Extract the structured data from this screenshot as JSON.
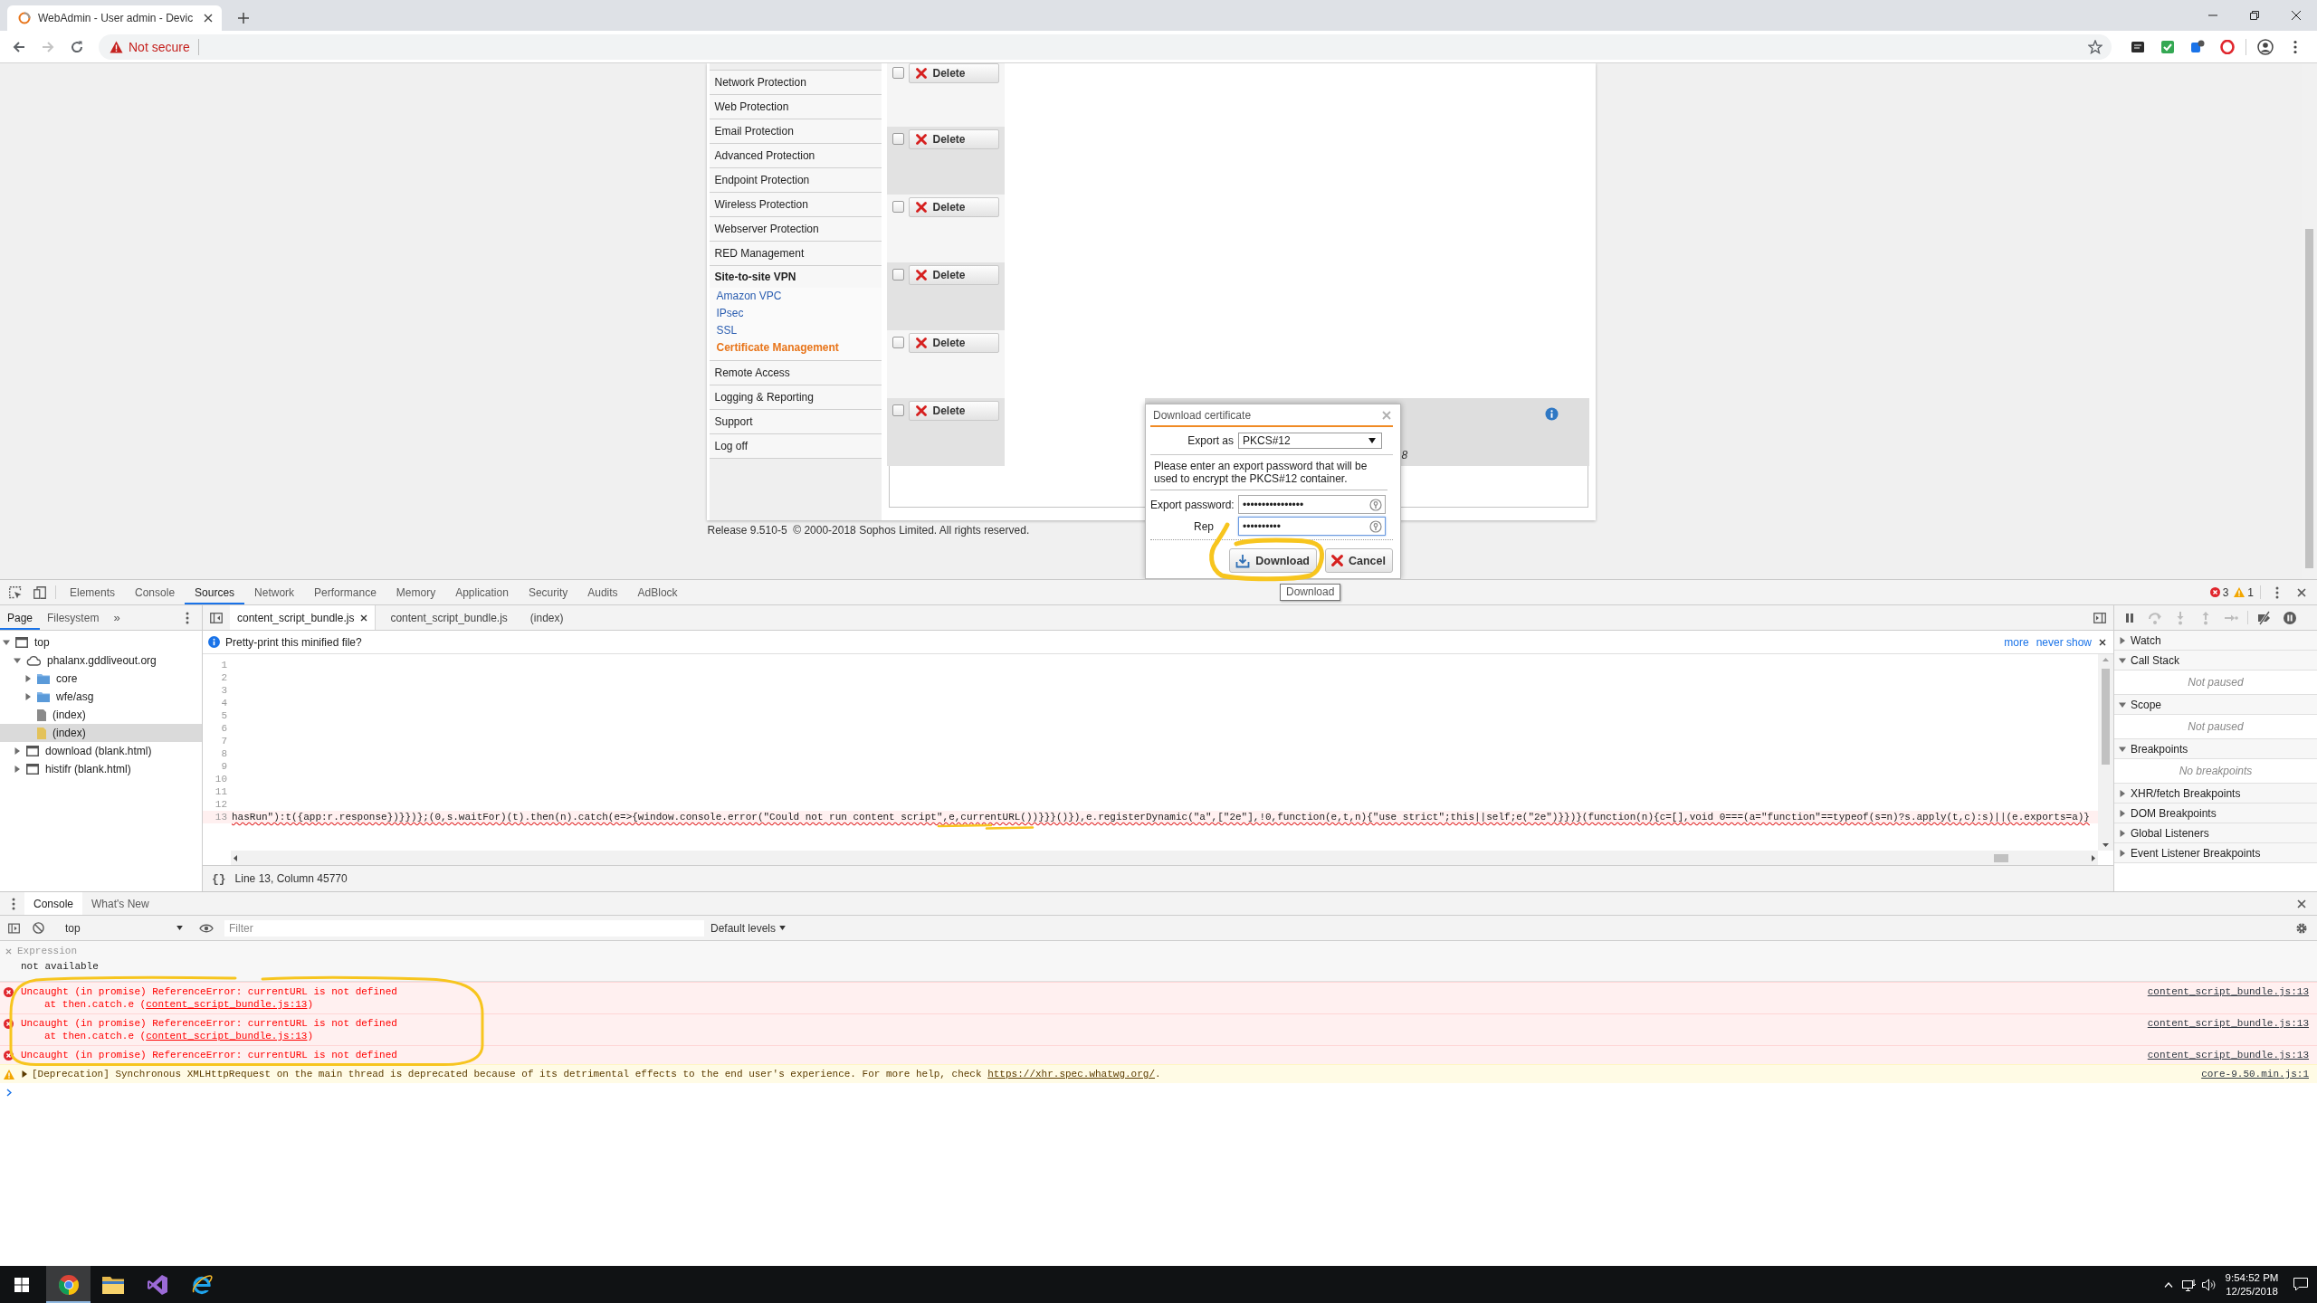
{
  "browser": {
    "tab_title": "WebAdmin - User admin - Devic",
    "back_enabled": true,
    "forward_enabled": false,
    "security_label": "Not secure"
  },
  "menu": [
    {
      "kind": "item",
      "label": "Network Protection",
      "selected": false
    },
    {
      "kind": "item",
      "label": "Web Protection",
      "selected": false
    },
    {
      "kind": "item",
      "label": "Email Protection",
      "selected": false
    },
    {
      "kind": "item",
      "label": "Advanced Protection",
      "selected": false
    },
    {
      "kind": "item",
      "label": "Endpoint Protection",
      "selected": false
    },
    {
      "kind": "item",
      "label": "Wireless Protection",
      "selected": false
    },
    {
      "kind": "item",
      "label": "Webserver Protection",
      "selected": false
    },
    {
      "kind": "item",
      "label": "RED Management",
      "selected": false
    },
    {
      "kind": "group",
      "label": "Site-to-site VPN",
      "selected": false,
      "expanded": true,
      "children": [
        {
          "label": "Amazon VPC",
          "selected": false
        },
        {
          "label": "IPsec",
          "selected": false
        },
        {
          "label": "SSL",
          "selected": false
        },
        {
          "label": "Certificate Management",
          "selected": true
        }
      ]
    },
    {
      "kind": "item",
      "label": "Remote Access",
      "selected": false
    },
    {
      "kind": "item",
      "label": "Logging & Reporting",
      "selected": false
    },
    {
      "kind": "item",
      "label": "Support",
      "selected": false
    },
    {
      "kind": "item",
      "label": "Log off",
      "selected": false
    }
  ],
  "rows": [
    {
      "checked": false,
      "action": "Delete"
    },
    {
      "checked": false,
      "action": "Delete"
    },
    {
      "checked": false,
      "action": "Delete"
    },
    {
      "checked": false,
      "action": "Delete"
    },
    {
      "checked": false,
      "action": "Delete"
    },
    {
      "checked": false,
      "action": "Delete",
      "fragment": "8"
    }
  ],
  "footer": "Release 9.510-5  © 2000-2018 Sophos Limited. All rights reserved.",
  "dialog": {
    "title": "Download certificate",
    "export_as": {
      "label": "Export as",
      "value": "PKCS#12"
    },
    "message": "Please enter an export password that will be used to encrypt the PKCS#12 container.",
    "fields": [
      {
        "label": "Export password:",
        "value": "••••••••••••••••",
        "focused": false
      },
      {
        "label": "Rep",
        "value": "••••••••••",
        "focused": true
      }
    ],
    "buttons": [
      {
        "kind": "download",
        "label": "Download"
      },
      {
        "kind": "cancel",
        "label": "Cancel"
      }
    ],
    "tooltip": "Download"
  },
  "devtools": {
    "tabs": [
      {
        "label": "Elements",
        "selected": false
      },
      {
        "label": "Console",
        "selected": false
      },
      {
        "label": "Sources",
        "selected": true
      },
      {
        "label": "Network",
        "selected": false
      },
      {
        "label": "Performance",
        "selected": false
      },
      {
        "label": "Memory",
        "selected": false
      },
      {
        "label": "Application",
        "selected": false
      },
      {
        "label": "Security",
        "selected": false
      },
      {
        "label": "Audits",
        "selected": false
      },
      {
        "label": "AdBlock",
        "selected": false
      }
    ],
    "error_count": "3",
    "warning_count": "1",
    "navigator": {
      "tabs": [
        {
          "label": "Page",
          "selected": true
        },
        {
          "label": "Filesystem",
          "selected": false
        }
      ],
      "overflow": "»",
      "tree": [
        {
          "kind": "frame",
          "label": "top",
          "expanded": true,
          "selected": false,
          "children": [
            {
              "kind": "domain",
              "label": "phalanx.gddliveout.org",
              "expanded": true,
              "selected": false,
              "children": [
                {
                  "kind": "folder",
                  "label": "core",
                  "expanded": false,
                  "selected": false
                },
                {
                  "kind": "folder",
                  "label": "wfe/asg",
                  "expanded": false,
                  "selected": false
                },
                {
                  "kind": "document",
                  "label": "(index)",
                  "selected": false
                },
                {
                  "kind": "script",
                  "label": "(index)",
                  "selected": true
                }
              ]
            },
            {
              "kind": "frame",
              "label": "download (blank.html)",
              "expanded": false,
              "selected": false
            },
            {
              "kind": "frame",
              "label": "histifr (blank.html)",
              "expanded": false,
              "selected": false
            }
          ]
        }
      ]
    },
    "editor": {
      "tabs": [
        {
          "label": "content_script_bundle.js",
          "selected": true,
          "closable": true
        },
        {
          "label": "content_script_bundle.js",
          "selected": false,
          "closable": false
        },
        {
          "label": "(index)",
          "selected": false,
          "closable": false
        }
      ],
      "infobar": {
        "text": "Pretty-print this minified file?",
        "links": [
          "more",
          "never show"
        ]
      },
      "lines": [
        {
          "number": "1",
          "error": false
        },
        {
          "number": "2",
          "error": false
        },
        {
          "number": "3",
          "error": false
        },
        {
          "number": "4",
          "error": false
        },
        {
          "number": "5",
          "error": false
        },
        {
          "number": "6",
          "error": false
        },
        {
          "number": "7",
          "error": false
        },
        {
          "number": "8",
          "error": false
        },
        {
          "number": "9",
          "error": false
        },
        {
          "number": "10",
          "error": false
        },
        {
          "number": "11",
          "error": false
        },
        {
          "number": "12",
          "error": false
        },
        {
          "number": "13",
          "error": true,
          "code": "hasRun\"):t({app:r.response})}})};(0,s.waitFor)(t).then(n).catch(e=>{window.console.error(\"Could not run content script\",e,currentURL())}}}()}),e.registerDynamic(\"a\",[\"2e\"],!0,function(e,t,n){\"use strict\";this||self;e(\"2e\")}})}(function(n){c=[],void 0===(a=\"function\"==typeof(s=n)?s.apply(t,c):s)||(e.exports=a)}"
        }
      ],
      "pretty_print": "{}",
      "status": "Line 13, Column 45770"
    },
    "debugger": {
      "controls": [
        {
          "kind": "pause",
          "disabled": false
        },
        {
          "kind": "step-over",
          "disabled": true
        },
        {
          "kind": "step-into",
          "disabled": true
        },
        {
          "kind": "step-out",
          "disabled": true
        },
        {
          "kind": "step",
          "disabled": true
        },
        {
          "kind": "deactivate",
          "disabled": false
        },
        {
          "kind": "pause-on-exceptions",
          "disabled": false
        }
      ],
      "sections": [
        {
          "title": "Watch",
          "expanded": false
        },
        {
          "title": "Call Stack",
          "expanded": true,
          "message": "Not paused"
        },
        {
          "title": "Scope",
          "expanded": true,
          "message": "Not paused"
        },
        {
          "title": "Breakpoints",
          "expanded": true,
          "message": "No breakpoints"
        },
        {
          "title": "XHR/fetch Breakpoints",
          "expanded": false
        },
        {
          "title": "DOM Breakpoints",
          "expanded": false
        },
        {
          "title": "Global Listeners",
          "expanded": false
        },
        {
          "title": "Event Listener Breakpoints",
          "expanded": false
        }
      ]
    }
  },
  "console": {
    "tabs": [
      {
        "label": "Console",
        "selected": true
      },
      {
        "label": "What's New",
        "selected": false
      }
    ],
    "context": "top",
    "filter_placeholder": "Filter",
    "levels": "Default levels",
    "expression": {
      "label": "Expression",
      "value": "not available"
    },
    "messages": [
      {
        "kind": "error",
        "text": "Uncaught (in promise) ReferenceError: currentURL is not defined",
        "trace": {
          "text": "at then.catch.e (",
          "link": "content_script_bundle.js:13",
          "end": ")"
        },
        "source": "content_script_bundle.js:13"
      },
      {
        "kind": "error",
        "text": "Uncaught (in promise) ReferenceError: currentURL is not defined",
        "trace": {
          "text": "at then.catch.e (",
          "link": "content_script_bundle.js:13",
          "end": ")"
        },
        "source": "content_script_bundle.js:13"
      },
      {
        "kind": "error",
        "text": "Uncaught (in promise) ReferenceError: currentURL is not defined",
        "source": "content_script_bundle.js:13"
      },
      {
        "kind": "warning",
        "expanded": false,
        "text": "[Deprecation] Synchronous XMLHttpRequest on the main thread is deprecated because of its detrimental effects to the end user's experience. For more help, check ",
        "link": "https://xhr.spec.whatwg.org/",
        "end": ".",
        "source": "core-9.50.min.js:1"
      }
    ]
  },
  "taskbar": {
    "apps": [
      {
        "kind": "browser",
        "active": true
      },
      {
        "kind": "folder",
        "active": false
      },
      {
        "kind": "ide",
        "active": false
      },
      {
        "kind": "web",
        "active": false
      }
    ],
    "time": "9:54:52 PM",
    "date": "12/25/2018"
  }
}
